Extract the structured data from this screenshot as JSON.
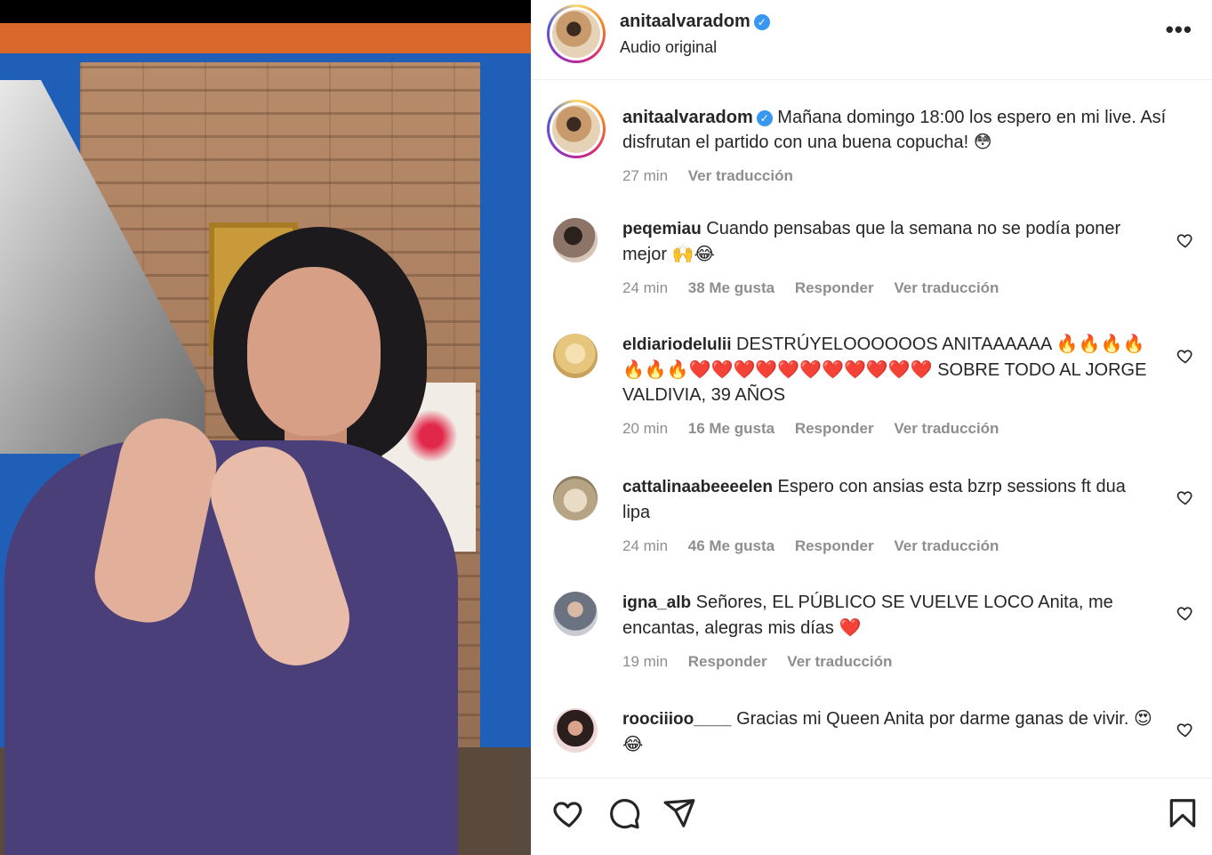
{
  "post": {
    "username": "anitaalvaradom",
    "audio": "Audio original",
    "more_glyph": "•••",
    "verified_glyph": "✓"
  },
  "caption": {
    "text": "Mañana domingo 18:00 los espero en mi live. Así disfrutan el partido con una buena copucha! 😳",
    "time": "27 min",
    "translate": "Ver traducción"
  },
  "comments": [
    {
      "username": "peqemiau",
      "text": "Cuando pensabas que la semana no se podía poner mejor 🙌😂",
      "time": "24 min",
      "likes": "38 Me gusta",
      "reply": "Responder",
      "translate": "Ver traducción",
      "avatar_color": "#6b5a52"
    },
    {
      "username": "eldiariodelulii",
      "text": "DESTRÚYELOOOOOOS ANITAAAAAA 🔥🔥🔥🔥🔥🔥🔥❤️❤️❤️❤️❤️❤️❤️❤️❤️❤️❤️ SOBRE TODO AL JORGE VALDIVIA, 39 AÑOS",
      "time": "20 min",
      "likes": "16 Me gusta",
      "reply": "Responder",
      "translate": "Ver traducción",
      "avatar_color": "#e8c98a"
    },
    {
      "username": "cattalinaabeeeelen",
      "text": "Espero con ansias esta bzrp sessions ft dua lipa",
      "time": "24 min",
      "likes": "46 Me gusta",
      "reply": "Responder",
      "translate": "Ver traducción",
      "avatar_color": "#a89a7c"
    },
    {
      "username": "igna_alb",
      "text": "Señores, EL PÚBLICO SE VUELVE LOCO Anita, me encantas, alegras mis días ❤️",
      "time": "19 min",
      "likes": "",
      "reply": "Responder",
      "translate": "Ver traducción",
      "avatar_color": "#8a8f98"
    },
    {
      "username": "roociiioo____",
      "text": "Gracias mi Queen Anita por darme ganas de vivir. 😍😂",
      "time": "",
      "likes": "",
      "reply": "",
      "translate": "",
      "avatar_color": "#3a2a2a"
    }
  ],
  "icons": {
    "like": "heart-icon",
    "comment": "comment-icon",
    "share": "send-icon",
    "save": "bookmark-icon"
  }
}
